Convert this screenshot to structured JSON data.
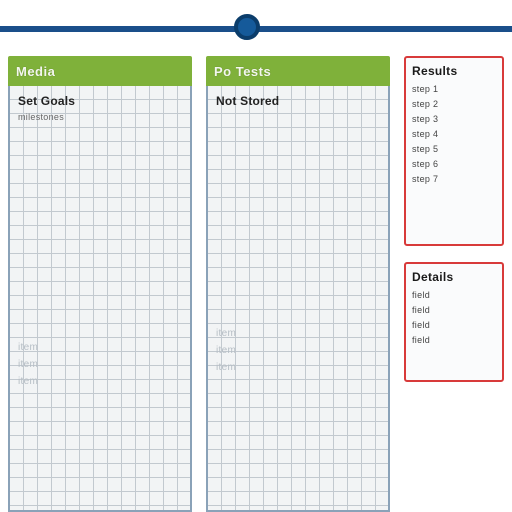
{
  "marker": {
    "name": "timeline-dot"
  },
  "columns": [
    {
      "header": "Media",
      "section": {
        "title": "Set Goals",
        "subtitle": "milestones"
      },
      "faint": [
        "item",
        "item",
        "item"
      ]
    },
    {
      "header": "Po Tests",
      "section": {
        "title": "Not Stored",
        "subtitle": ""
      },
      "faint": [
        "item",
        "item",
        "item"
      ]
    }
  ],
  "side": {
    "upper": {
      "title": "Results",
      "items": [
        "step 1",
        "step 2",
        "step 3",
        "step 4",
        "step 5",
        "step 6",
        "step 7"
      ]
    },
    "lower": {
      "title": "Details",
      "items": [
        "field",
        "field",
        "field",
        "field"
      ]
    }
  }
}
